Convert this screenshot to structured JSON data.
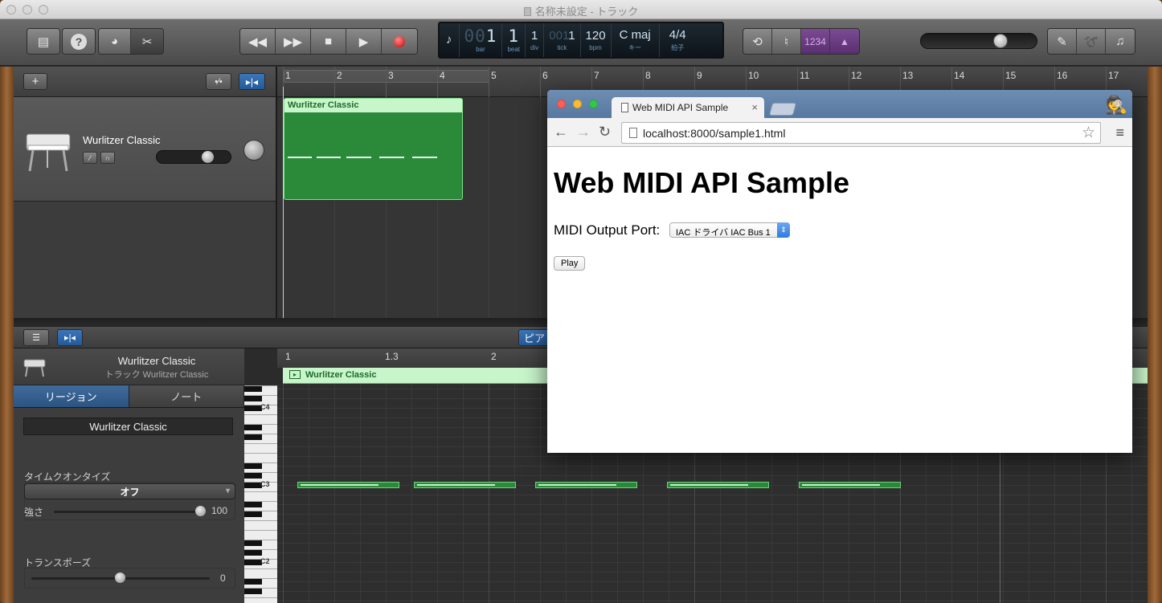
{
  "window": {
    "title": "名称未設定 - トラック"
  },
  "toolbar": {
    "lcd": {
      "bar": "00",
      "bar_value": "1",
      "beat": "1",
      "div": "1",
      "tick": "001",
      "tick_value": "1",
      "tempo": "120",
      "key": "C maj",
      "time_signature": "4/4",
      "labels": {
        "bar": "bar",
        "beat": "beat",
        "div": "div",
        "tick": "tick",
        "bpm": "bpm",
        "key": "キー",
        "sig": "拍子"
      }
    },
    "count_in_label": "1234",
    "master_volume": 0.68
  },
  "track": {
    "name": "Wurlitzer Classic",
    "volume": 0.62
  },
  "ruler": {
    "bars": [
      "1",
      "2",
      "3",
      "4",
      "5",
      "6",
      "7",
      "8",
      "9",
      "10",
      "11",
      "12",
      "13",
      "14",
      "15",
      "16",
      "17"
    ]
  },
  "region": {
    "name": "Wurlitzer Classic"
  },
  "editor": {
    "title": "Wurlitzer Classic",
    "subtitle": "トラック Wurlitzer Classic",
    "tab_region": "リージョン",
    "tab_note": "ノート",
    "region_name": "Wurlitzer Classic",
    "time_quantize_label": "タイムクオンタイズ",
    "time_quantize_value": "オフ",
    "strength_label": "強さ",
    "strength_value": "100",
    "transpose_label": "トランスポーズ",
    "transpose_value": "0",
    "piano_roll_button": "ピア",
    "ruler": [
      "1",
      "1.3",
      "2"
    ],
    "key_labels": [
      "C4",
      "C3",
      "C2"
    ]
  },
  "browser": {
    "tab_title": "Web MIDI API Sample",
    "url": "localhost:8000/sample1.html",
    "page": {
      "heading": "Web MIDI API Sample",
      "port_label": "MIDI Output Port:",
      "port_value": "IAC ドライバ IAC Bus 1",
      "play_button": "Play"
    }
  }
}
